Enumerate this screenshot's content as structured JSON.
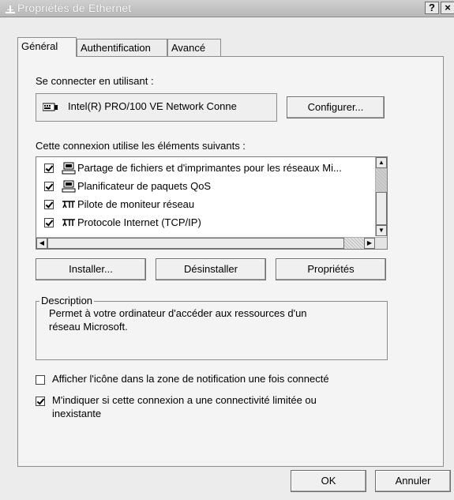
{
  "window": {
    "title": "Propriétés de Ethernet",
    "help_button": "?",
    "close_button": "×"
  },
  "tabs": [
    {
      "label": "Général",
      "active": true
    },
    {
      "label": "Authentification",
      "active": false
    },
    {
      "label": "Avancé",
      "active": false
    }
  ],
  "connect_using": {
    "label": "Se connecter en utilisant :",
    "adapter": "Intel(R) PRO/100 VE Network Conne",
    "configure_label": "Configurer..."
  },
  "components": {
    "label": "Cette connexion utilise les éléments suivants :",
    "items": [
      {
        "label": "Partage de fichiers et d'imprimantes pour les réseaux Mi...",
        "checked": true,
        "icon": "computer-icon"
      },
      {
        "label": "Planificateur de paquets QoS",
        "checked": true,
        "icon": "computer-icon"
      },
      {
        "label": "Pilote de moniteur réseau",
        "checked": true,
        "icon": "network-protocol-icon"
      },
      {
        "label": "Protocole Internet (TCP/IP)",
        "checked": true,
        "icon": "network-protocol-icon"
      }
    ]
  },
  "actions": {
    "install": "Installer...",
    "uninstall": "Désinstaller",
    "properties": "Propriétés"
  },
  "description": {
    "legend": "Description",
    "text_line1": "Permet à votre ordinateur d'accéder aux ressources d'un",
    "text_line2": "réseau Microsoft."
  },
  "options": {
    "show_icon": {
      "label": "Afficher l'icône dans la zone de notification une fois connecté",
      "checked": false
    },
    "notify_limited_line1": "M'indiquer si cette connexion a une connectivité limitée ou",
    "notify_limited_line2": "inexistante",
    "notify_limited_checked": true
  },
  "footer": {
    "ok": "OK",
    "cancel": "Annuler"
  },
  "colors": {
    "titlebar": "#bdbdbd",
    "dialog_bg": "#ececec",
    "panel_bg": "#f4f4f4"
  }
}
